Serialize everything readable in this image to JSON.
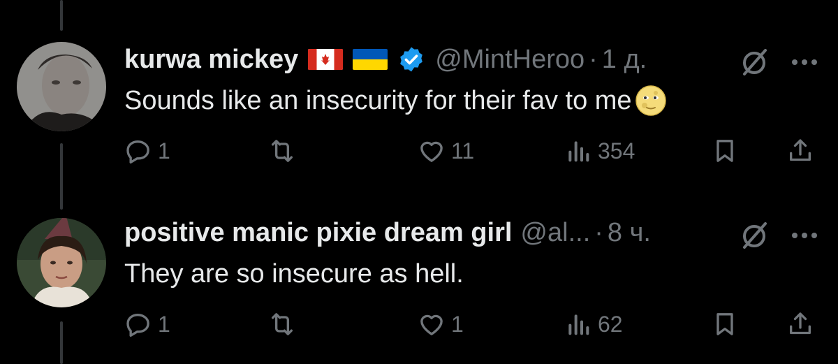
{
  "tweets": [
    {
      "display_name": "kurwa mickey",
      "handle": "@MintHeroo",
      "separator": "·",
      "time": "1 д.",
      "text": "Sounds like an insecurity for their fav to me",
      "replies": "1",
      "reposts": "",
      "likes": "11",
      "views": "354",
      "flags": [
        "canada-flag",
        "ukraine-flag"
      ],
      "verified": true,
      "emoji": "moon-face-emoji"
    },
    {
      "display_name": "positive manic pixie dream girl",
      "handle": "@al...",
      "separator": "·",
      "time": "8 ч.",
      "text": "They are so insecure as hell.",
      "replies": "1",
      "reposts": "",
      "likes": "1",
      "views": "62",
      "flags": [],
      "verified": false
    }
  ],
  "colors": {
    "background": "#000000",
    "text": "#e7e9ea",
    "muted": "#71767b",
    "verified": "#1d9bf0",
    "thread_line": "#333639"
  }
}
